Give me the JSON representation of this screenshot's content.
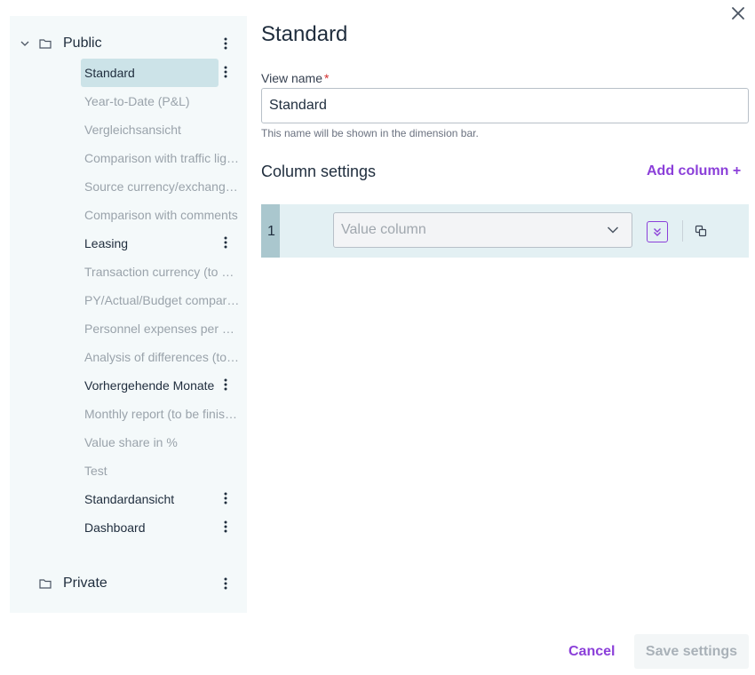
{
  "dialog": {
    "close_icon": "close-icon"
  },
  "sidebar": {
    "public_folder": {
      "label": "Public",
      "icon": "folder-icon",
      "expanded": true
    },
    "private_folder": {
      "label": "Private",
      "icon": "folder-icon",
      "expanded": false
    },
    "views": [
      {
        "label": "Standard",
        "active": true,
        "selected": true,
        "menu": true
      },
      {
        "label": "Year-to-Date (P&L)",
        "active": false,
        "selected": false,
        "menu": false
      },
      {
        "label": "Vergleichsansicht",
        "active": false,
        "selected": false,
        "menu": false
      },
      {
        "label": "Comparison with traffic lights",
        "active": false,
        "selected": false,
        "menu": false
      },
      {
        "label": "Source currency/exchange rates",
        "active": false,
        "selected": false,
        "menu": false
      },
      {
        "label": "Comparison with comments",
        "active": false,
        "selected": false,
        "menu": false
      },
      {
        "label": "Leasing",
        "active": true,
        "selected": false,
        "menu": true
      },
      {
        "label": "Transaction currency (to be finished)",
        "active": false,
        "selected": false,
        "menu": false
      },
      {
        "label": "PY/Actual/Budget comparison",
        "active": false,
        "selected": false,
        "menu": false
      },
      {
        "label": "Personnel expenses per employee",
        "active": false,
        "selected": false,
        "menu": false
      },
      {
        "label": "Analysis of differences (to be finished)",
        "active": false,
        "selected": false,
        "menu": false
      },
      {
        "label": "Vorhergehende Monate",
        "active": true,
        "selected": false,
        "menu": true
      },
      {
        "label": "Monthly report (to be finished)",
        "active": false,
        "selected": false,
        "menu": false
      },
      {
        "label": "Value share in %",
        "active": false,
        "selected": false,
        "menu": false
      },
      {
        "label": "Test",
        "active": false,
        "selected": false,
        "menu": false
      },
      {
        "label": "Standardansicht",
        "active": true,
        "selected": false,
        "menu": true
      },
      {
        "label": "Dashboard",
        "active": true,
        "selected": false,
        "menu": true
      }
    ]
  },
  "main": {
    "title": "Standard",
    "view_name_label": "View name",
    "required_mark": "*",
    "view_name_value": "Standard",
    "view_name_hint": "This name will be shown in the dimension bar.",
    "column_settings_title": "Column settings",
    "add_column_label": "Add column +",
    "columns": [
      {
        "number": "1",
        "placeholder": "Value column"
      }
    ]
  },
  "footer": {
    "cancel_label": "Cancel",
    "save_label": "Save settings"
  },
  "colors": {
    "accent": "#8b3fd9",
    "sidebar_bg": "#f4f9fa",
    "selected_bg": "#cce3e8",
    "column_row_bg": "#e3f0f3",
    "required": "#d32f2f"
  }
}
